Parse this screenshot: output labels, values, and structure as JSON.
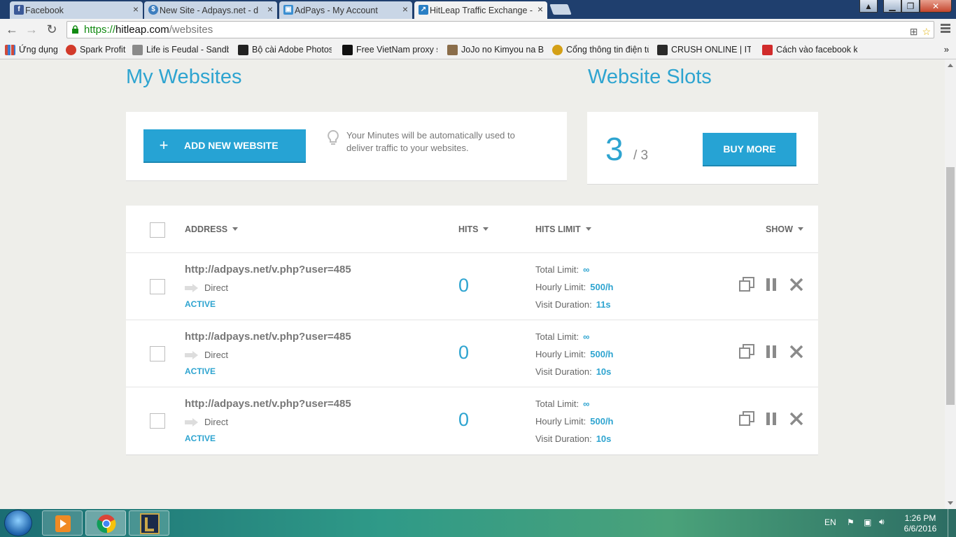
{
  "browser": {
    "tabs": [
      {
        "title": "Facebook",
        "icon": "facebook-icon",
        "color": "#3b5998",
        "glyph": "f"
      },
      {
        "title": "New Site - Adpays.net - d",
        "icon": "adpays-icon",
        "color": "#3d7ebf",
        "glyph": "$"
      },
      {
        "title": "AdPays - My Account",
        "icon": "cube-icon",
        "color": "#3b8fd1",
        "glyph": "▣"
      },
      {
        "title": "HitLeap Traffic Exchange -",
        "icon": "hitleap-icon",
        "color": "#2a7fc4",
        "glyph": "↗"
      }
    ],
    "url": {
      "scheme": "https://",
      "host": "hitleap.com",
      "path": "/websites"
    },
    "bookmarks": [
      {
        "label": "Ứng dụng",
        "color": "#d04a3a"
      },
      {
        "label": "Spark Profit",
        "color": "#d23a2a"
      },
      {
        "label": "Life is Feudal - Sandb",
        "color": "#777777"
      },
      {
        "label": "Bộ cài Adobe Photosh",
        "color": "#222222"
      },
      {
        "label": "Free VietNam proxy s",
        "color": "#111111"
      },
      {
        "label": "JoJo no Kimyou na Bo",
        "color": "#8a6d4a"
      },
      {
        "label": "Cổng thông tin điện tử",
        "color": "#d4a017"
      },
      {
        "label": "CRUSH ONLINE | IT'S",
        "color": "#2a2a2a"
      },
      {
        "label": "Cách vào facebook kh",
        "color": "#d12b2b"
      }
    ]
  },
  "page": {
    "my_websites_title": "My Websites",
    "slots_title": "Website Slots",
    "add_button": "ADD NEW WEBSITE",
    "add_plus": "+",
    "tip": "Your Minutes will be automatically used to deliver traffic to your websites.",
    "slots_used": "3",
    "slots_total": "/ 3",
    "buy_button": "BUY MORE",
    "table": {
      "headers": {
        "address": "ADDRESS",
        "hits": "HITS",
        "hits_limit": "HITS LIMIT",
        "show": "SHOW"
      },
      "rows": [
        {
          "address": "http://adpays.net/v.php?user=485",
          "source": "Direct",
          "status": "ACTIVE",
          "hits": "0",
          "total_label": "Total Limit:",
          "total": "∞",
          "hourly_label": "Hourly Limit:",
          "hourly": "500/h",
          "duration_label": "Visit Duration:",
          "duration": "11s"
        },
        {
          "address": "http://adpays.net/v.php?user=485",
          "source": "Direct",
          "status": "ACTIVE",
          "hits": "0",
          "total_label": "Total Limit:",
          "total": "∞",
          "hourly_label": "Hourly Limit:",
          "hourly": "500/h",
          "duration_label": "Visit Duration:",
          "duration": "10s"
        },
        {
          "address": "http://adpays.net/v.php?user=485",
          "source": "Direct",
          "status": "ACTIVE",
          "hits": "0",
          "total_label": "Total Limit:",
          "total": "∞",
          "hourly_label": "Hourly Limit:",
          "hourly": "500/h",
          "duration_label": "Visit Duration:",
          "duration": "10s"
        }
      ]
    }
  },
  "taskbar": {
    "lang": "EN",
    "time": "1:26 PM",
    "date": "6/6/2016"
  },
  "colors": {
    "accent": "#26a3d4",
    "text_blue": "#2ea4d0"
  }
}
